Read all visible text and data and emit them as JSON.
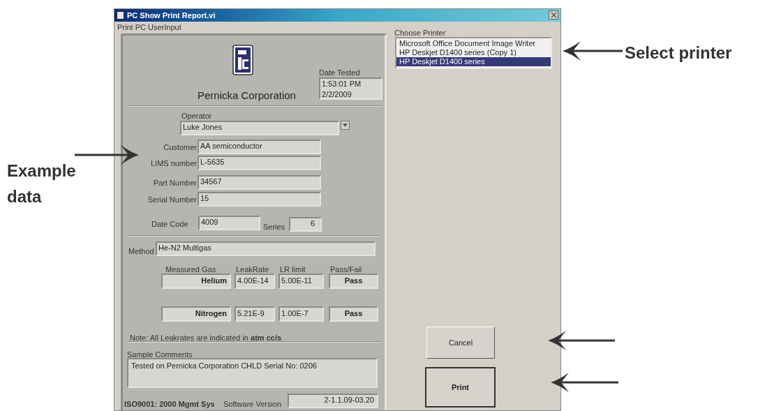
{
  "window": {
    "title": "PC Show Print Report.vi"
  },
  "report": {
    "title": "Print PC UserInput",
    "company": "Pernicka Corporation",
    "date_tested": {
      "label": "Date Tested",
      "value": "1:53:01 PM\n2/2/2009"
    },
    "operator": {
      "label": "Operator",
      "value": "Luke Jones"
    },
    "fields": [
      {
        "label": "Customer",
        "value": "AA semiconductor"
      },
      {
        "label": "LIMS number",
        "value": "L-5635"
      },
      {
        "label": "Part Number",
        "value": "34567"
      },
      {
        "label": "Serial Number",
        "value": "15"
      }
    ],
    "date_code": {
      "label": "Date Code",
      "value": "4009"
    },
    "series": {
      "label": "Series",
      "value": "6"
    },
    "method": {
      "label": "Method",
      "value": "He-N2 Multigas"
    },
    "gas_table": {
      "columns": [
        "Measured Gas",
        "LeakRate",
        "LR limit",
        "Pass/Fail"
      ],
      "rows": [
        {
          "gas": "Helium",
          "leak_rate": "4.00E-14",
          "lr_limit": "5.00E-11",
          "result": "Pass"
        },
        {
          "gas": "Nitrogen",
          "leak_rate": "5.21E-9",
          "lr_limit": "1.00E-7",
          "result": "Pass"
        }
      ]
    },
    "note": "Note: All Leakrates are indicated in  **atm cc/s**",
    "comments": {
      "label": "Sample Comments",
      "value": "Tested on Pernicka Corporation CHLD Serial No: 0206"
    },
    "footer": {
      "iso": "ISO9001: 2000 Mgmt Sys",
      "software_label": "Software Version",
      "software_version": "2-1.1.09-03.20"
    }
  },
  "printer": {
    "label": "Choose Printer",
    "items": [
      {
        "label": "Microsoft Office Document Image Writer",
        "selected": false
      },
      {
        "label": "HP Deskjet D1400 series (Copy 1)",
        "selected": false
      },
      {
        "label": "HP Deskjet D1400 series",
        "selected": true
      }
    ]
  },
  "buttons": [
    {
      "label": "Cancel",
      "kind": "normal"
    },
    {
      "label": "Print",
      "kind": "default"
    }
  ],
  "annotations": [
    {
      "text": "Example data"
    },
    {
      "text": "Select printer"
    }
  ]
}
